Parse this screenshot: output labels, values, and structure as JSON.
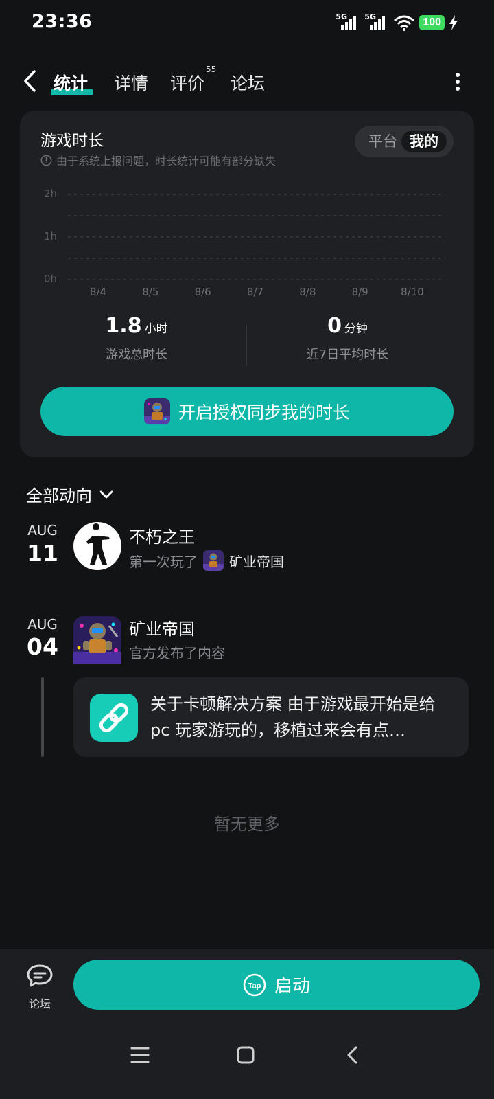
{
  "status_bar": {
    "time": "23:36",
    "signal1_label": "5G",
    "signal2_label": "5G",
    "battery": "100"
  },
  "nav": {
    "tabs": [
      {
        "label": "统计",
        "active": true
      },
      {
        "label": "详情",
        "active": false
      },
      {
        "label": "评价",
        "active": false
      },
      {
        "label": "论坛",
        "active": false
      }
    ],
    "review_count": "55"
  },
  "playtime_card": {
    "title": "游戏时长",
    "note": "由于系统上报问题，时长统计可能有部分缺失",
    "toggle_options": [
      "平台",
      "我的"
    ],
    "toggle_selected": "我的",
    "total_value": "1.8",
    "total_unit": "小时",
    "total_label": "游戏总时长",
    "avg_value": "0",
    "avg_unit": "分钟",
    "avg_label": "近7日平均时长",
    "sync_button": "开启授权同步我的时长"
  },
  "chart_data": {
    "type": "bar",
    "categories": [
      "8/4",
      "8/5",
      "8/6",
      "8/7",
      "8/8",
      "8/9",
      "8/10"
    ],
    "values": [
      0,
      0,
      0,
      0,
      0,
      0,
      0
    ],
    "y_tick_labels": [
      "2h",
      "1h",
      "0h"
    ],
    "ylim": [
      0,
      2
    ],
    "grid": true
  },
  "feed": {
    "filter_label": "全部动向",
    "items": [
      {
        "month": "AUG",
        "day": "11",
        "name": "不朽之王",
        "action": "第一次玩了",
        "game": "矿业帝国"
      },
      {
        "month": "AUG",
        "day": "04",
        "name": "矿业帝国",
        "action": "官方发布了内容",
        "post_text": "关于卡顿解决方案 由于游戏最开始是给pc 玩家游玩的，移植过来会有点…"
      }
    ],
    "no_more": "暂无更多"
  },
  "bottom_bar": {
    "forum_label": "论坛",
    "launch_label": "启动",
    "tap_logo_text": "Tap"
  },
  "colors": {
    "accent": "#0eb7a7",
    "background": "#121315",
    "card": "#1e2023"
  }
}
